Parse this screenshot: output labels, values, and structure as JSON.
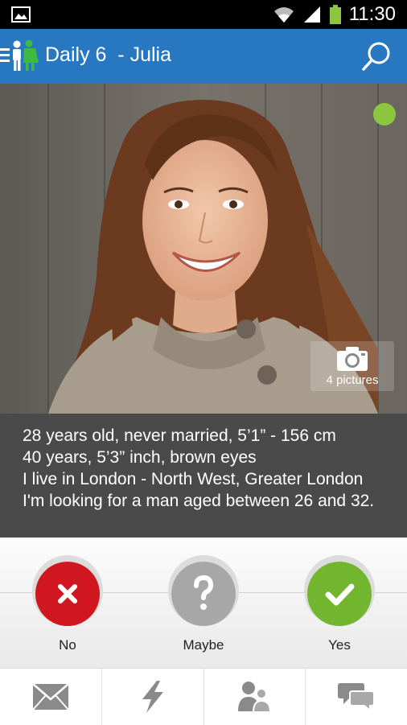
{
  "status_bar": {
    "time": "11:30"
  },
  "header": {
    "title": "Daily 6  - Julia"
  },
  "photo": {
    "pictures_label": "4 pictures"
  },
  "profile": {
    "lines": [
      "28 years old, never married, 5’1” - 156 cm",
      "40 years, 5’3” inch, brown eyes",
      "I live in London - North West, Greater London",
      "I'm looking for a man aged between 26 and 32."
    ]
  },
  "actions": {
    "no_label": "No",
    "maybe_label": "Maybe",
    "yes_label": "Yes"
  },
  "colors": {
    "app_bar": "#2778c1",
    "no": "#d0161f",
    "maybe": "#a7a7a7",
    "yes": "#72b62f",
    "online": "#8cc63f"
  },
  "nav": {
    "icons": [
      "mail-icon",
      "flash-icon",
      "people-icon",
      "chat-icon"
    ]
  }
}
